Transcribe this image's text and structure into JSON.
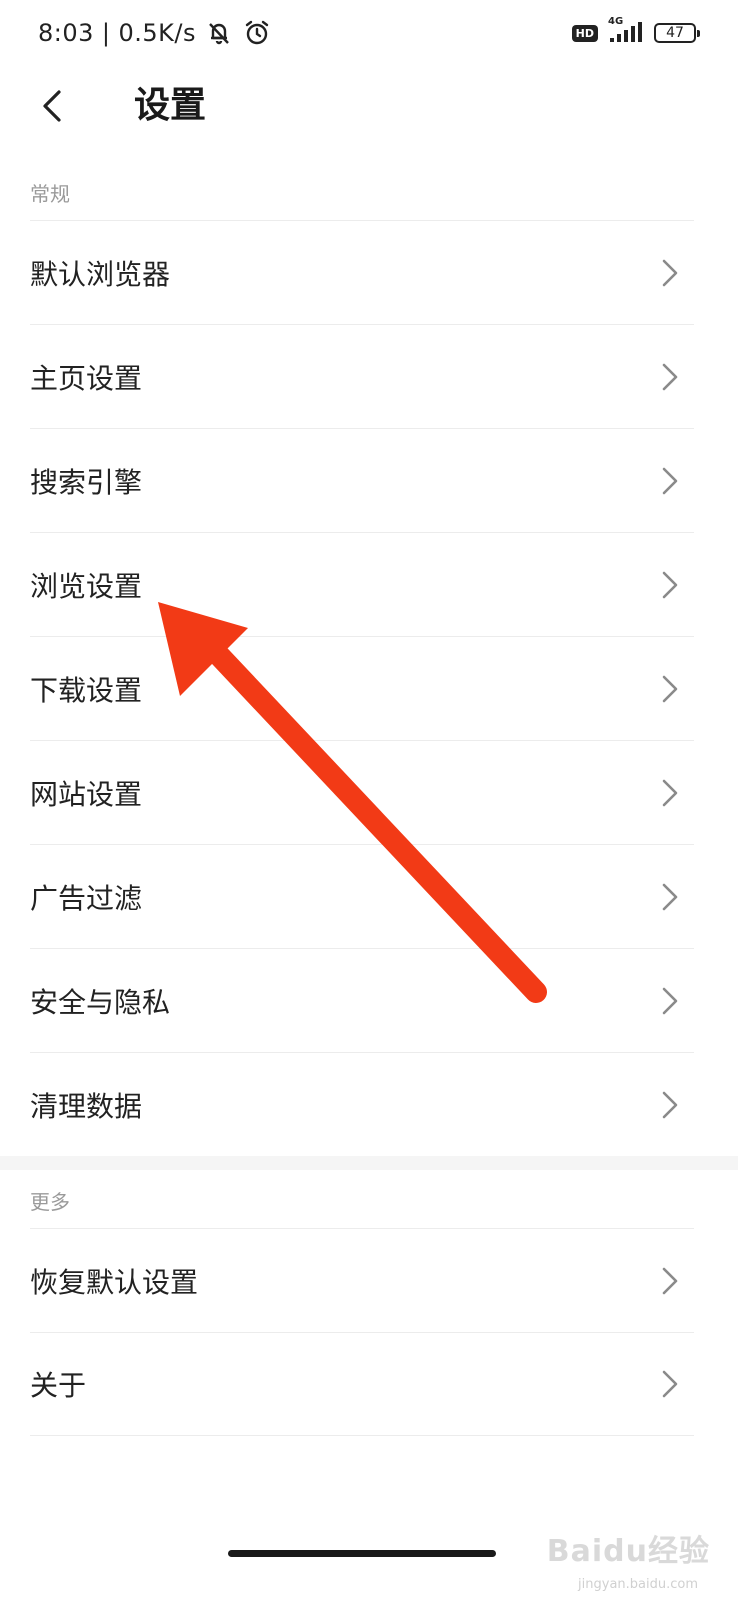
{
  "status_bar": {
    "time": "8:03",
    "separator": "|",
    "net_speed": "0.5K/s",
    "hd_label": "HD",
    "network_type": "4G",
    "battery_level": "47",
    "icons": [
      "bell-muted-icon",
      "alarm-icon",
      "signal-icon",
      "battery-icon"
    ]
  },
  "header": {
    "title": "设置",
    "back_icon": "chevron-left-icon"
  },
  "sections": {
    "general": {
      "label": "常规",
      "items": [
        {
          "label": "默认浏览器"
        },
        {
          "label": "主页设置"
        },
        {
          "label": "搜索引擎"
        },
        {
          "label": "浏览设置"
        },
        {
          "label": "下载设置"
        },
        {
          "label": "网站设置"
        },
        {
          "label": "广告过滤"
        },
        {
          "label": "安全与隐私"
        },
        {
          "label": "清理数据"
        }
      ]
    },
    "more": {
      "label": "更多",
      "items": [
        {
          "label": "恢复默认设置"
        },
        {
          "label": "关于"
        }
      ]
    }
  },
  "annotation": {
    "color": "#f23a16",
    "points_to": "浏览设置"
  },
  "watermark": {
    "main": "Baidu经验",
    "sub": "jingyan.baidu.com"
  },
  "colors": {
    "background": "#ffffff",
    "text": "#222222",
    "section_label": "#9a9a9a",
    "divider": "#ececec",
    "chevron": "#8a8a8a"
  }
}
